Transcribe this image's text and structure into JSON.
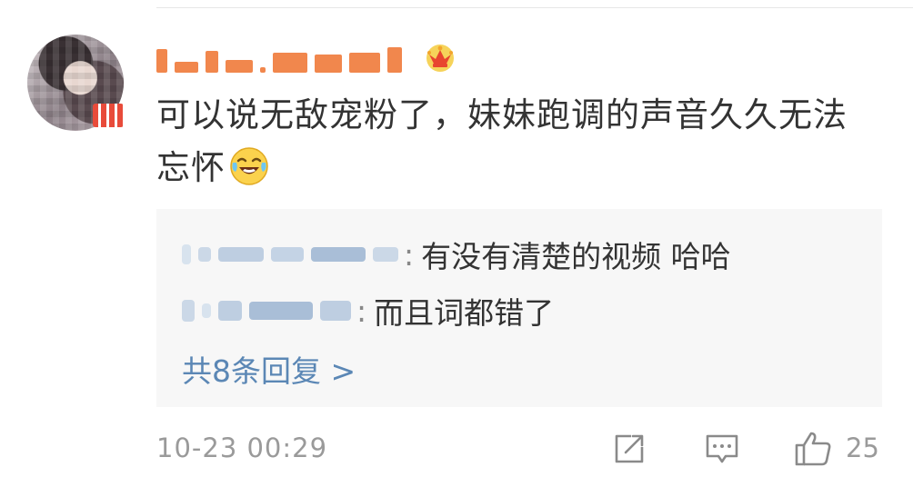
{
  "comment": {
    "username": "",
    "text": "可以说无敌宠粉了，妹妹跑调的声音久久无法忘怀",
    "timestamp": "10-23 00:29",
    "like_count": "25"
  },
  "replies": [
    {
      "author": "",
      "text": "有没有清楚的视频 哈哈"
    },
    {
      "author": "",
      "text": "而且词都错了"
    }
  ],
  "more_replies_label": "共8条回复 >",
  "colors": {
    "link": "#5b87b5",
    "username": "#f07a3a",
    "reply_box_bg": "#f7f7f7",
    "meta_text": "#9a9a9a"
  },
  "icons": [
    "crown-icon",
    "laugh-cry-emoji-icon",
    "share-icon",
    "comment-icon",
    "like-icon"
  ]
}
